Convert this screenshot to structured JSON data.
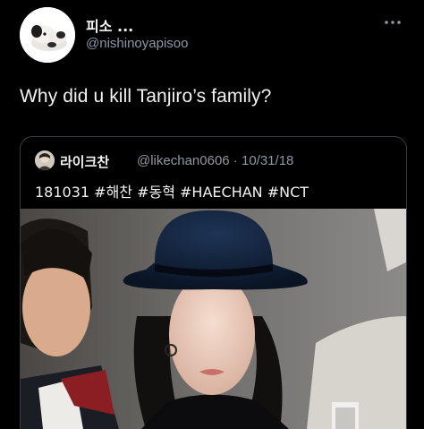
{
  "tweet": {
    "display_name": "피소 ...",
    "handle": "@nishinoyapisoo",
    "text": "Why did u kill Tanjiro’s family?",
    "more_icon": "more-dots-icon",
    "avatar_icon": "plush-dog-avatar"
  },
  "quoted_tweet": {
    "display_name": "라이크찬",
    "handle": "@likechan0606",
    "separator": " · ",
    "date": "10/31/18",
    "text": "181031 #해찬 #동혁 #HAECHAN #NCT",
    "photo_description_icon": "person-in-black-fedora-photo"
  },
  "colors": {
    "background": "#000000",
    "primary_text": "#f2f2f2",
    "secondary_text": "#8b98a5",
    "border": "#3a3f44"
  }
}
